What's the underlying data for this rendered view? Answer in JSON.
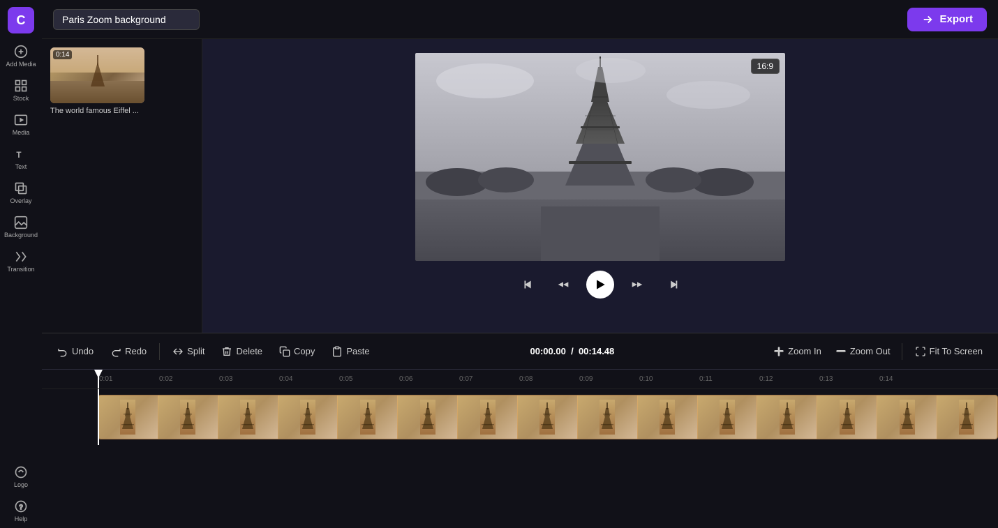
{
  "app": {
    "logo": "C",
    "logo_bg": "#7c3aed"
  },
  "header": {
    "project_title": "Paris Zoom background",
    "export_label": "Export"
  },
  "sidebar": {
    "items": [
      {
        "id": "add-media",
        "label": "Add Media",
        "icon": "plus-icon"
      },
      {
        "id": "stock",
        "label": "Stock",
        "icon": "stock-icon"
      },
      {
        "id": "media",
        "label": "Media",
        "icon": "media-icon"
      },
      {
        "id": "text",
        "label": "Text",
        "icon": "text-icon"
      },
      {
        "id": "overlay",
        "label": "Overlay",
        "icon": "overlay-icon"
      },
      {
        "id": "background",
        "label": "Background",
        "icon": "background-icon"
      },
      {
        "id": "transition",
        "label": "Transition",
        "icon": "transition-icon"
      },
      {
        "id": "logo",
        "label": "Logo",
        "icon": "logo-icon"
      }
    ]
  },
  "media_panel": {
    "items": [
      {
        "duration": "0:14",
        "caption": "The world famous Eiffel ..."
      }
    ]
  },
  "preview": {
    "aspect_ratio": "16:9"
  },
  "playback": {
    "skip_back_label": "skip-back",
    "rewind_label": "rewind",
    "play_label": "play",
    "fast_forward_label": "fast-forward",
    "skip_forward_label": "skip-forward"
  },
  "toolbar": {
    "undo_label": "Undo",
    "redo_label": "Redo",
    "split_label": "Split",
    "delete_label": "Delete",
    "copy_label": "Copy",
    "paste_label": "Paste",
    "zoom_in_label": "Zoom In",
    "zoom_out_label": "Zoom Out",
    "fit_to_screen_label": "Fit To Screen"
  },
  "timecode": {
    "current": "00:00",
    "current_frames": ".00",
    "separator": "/",
    "total": "00:14",
    "total_frames": ".48"
  },
  "timeline": {
    "ruler_marks": [
      "0:01",
      "0:02",
      "0:03",
      "0:04",
      "0:05",
      "0:06",
      "0:07",
      "0:08",
      "0:09",
      "0:10",
      "0:11",
      "0:12",
      "0:13",
      "0:14",
      ""
    ]
  }
}
